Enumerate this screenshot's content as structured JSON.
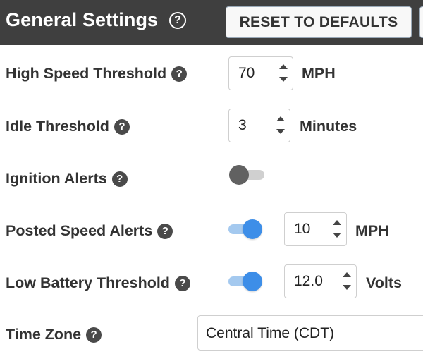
{
  "header": {
    "title": "General Settings",
    "help_glyph": "?",
    "reset_label": "RESET TO DEFAULTS"
  },
  "rows": {
    "high_speed": {
      "label": "High Speed Threshold",
      "value": "70",
      "unit": "MPH"
    },
    "idle": {
      "label": "Idle Threshold",
      "value": "3",
      "unit": "Minutes"
    },
    "ignition": {
      "label": "Ignition Alerts",
      "enabled": false
    },
    "posted_speed": {
      "label": "Posted Speed Alerts",
      "enabled": true,
      "value": "10",
      "unit": "MPH"
    },
    "low_battery": {
      "label": "Low Battery Threshold",
      "enabled": true,
      "value": "12.0",
      "unit": "Volts"
    },
    "time_zone": {
      "label": "Time Zone",
      "value": "Central Time (CDT)"
    }
  },
  "help_glyph": "?",
  "colors": {
    "header_bg": "#3f3f3f",
    "toggle_on": "#3d8ee8",
    "toggle_off": "#616161"
  }
}
